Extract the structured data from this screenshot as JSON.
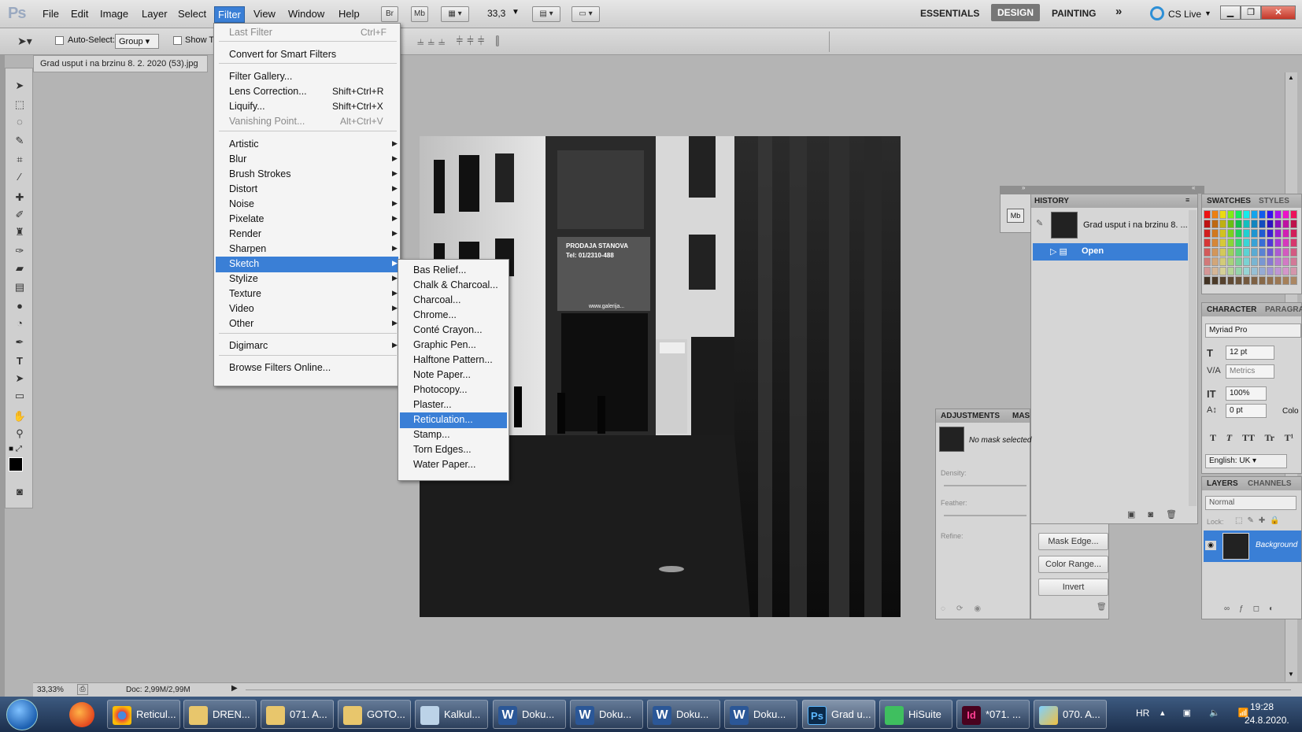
{
  "app": {
    "logo": "Ps"
  },
  "menubar": {
    "items": [
      "File",
      "Edit",
      "Image",
      "Layer",
      "Select",
      "Filter",
      "View",
      "Window",
      "Help"
    ],
    "bridge": "Br",
    "mini_bridge": "Mb",
    "zoom": "33,3",
    "workspaces": [
      "ESSENTIALS",
      "DESIGN",
      "PAINTING"
    ],
    "more": "»",
    "cslive": "CS Live"
  },
  "options": {
    "auto_select_label": "Auto-Select:",
    "auto_select_value": "Group",
    "show_transform": "Show T"
  },
  "document": {
    "tab_title": "Grad usput i na brzinu 8. 2. 2020 (53).jpg"
  },
  "filter_menu": {
    "last_filter": {
      "label": "Last Filter",
      "shortcut": "Ctrl+F"
    },
    "convert": "Convert for Smart Filters",
    "gallery": "Filter Gallery...",
    "lens": {
      "label": "Lens Correction...",
      "shortcut": "Shift+Ctrl+R"
    },
    "liquify": {
      "label": "Liquify...",
      "shortcut": "Shift+Ctrl+X"
    },
    "vanishing": {
      "label": "Vanishing Point...",
      "shortcut": "Alt+Ctrl+V"
    },
    "groups": [
      "Artistic",
      "Blur",
      "Brush Strokes",
      "Distort",
      "Noise",
      "Pixelate",
      "Render",
      "Sharpen",
      "Sketch",
      "Stylize",
      "Texture",
      "Video",
      "Other"
    ],
    "digimarc": "Digimarc",
    "browse": "Browse Filters Online..."
  },
  "sketch_submenu": {
    "items": [
      "Bas Relief...",
      "Chalk & Charcoal...",
      "Charcoal...",
      "Chrome...",
      "Conté Crayon...",
      "Graphic Pen...",
      "Halftone Pattern...",
      "Note Paper...",
      "Photocopy...",
      "Plaster...",
      "Reticulation...",
      "Stamp...",
      "Torn Edges...",
      "Water Paper..."
    ],
    "selected": "Reticulation..."
  },
  "photo_signs": {
    "sign1": "PRODAJA STANOVA",
    "sign2": "Tel: 01/2310-488",
    "sign3": "www.galerija..."
  },
  "history": {
    "tab": "HISTORY",
    "snapshot": "Grad usput i na brzinu 8. ...",
    "state": "Open"
  },
  "mini_bridge_label": "Mb",
  "adjustments": {
    "tabs": [
      "ADJUSTMENTS",
      "MAS"
    ],
    "no_mask": "No mask selected",
    "density": "Density:",
    "feather": "Feather:",
    "refine": "Refine:",
    "buttons": [
      "Mask Edge...",
      "Color Range...",
      "Invert"
    ]
  },
  "swatches": {
    "tabs": [
      "SWATCHES",
      "STYLES"
    ]
  },
  "character": {
    "tabs": [
      "CHARACTER",
      "PARAGRA"
    ],
    "font": "Myriad Pro",
    "size": "12 pt",
    "kerning": "Metrics",
    "scale": "100%",
    "baseline": "0 pt",
    "colo": "Colo",
    "language": "English: UK",
    "styles": [
      "T",
      "T",
      "TT",
      "Tr",
      "T¹"
    ]
  },
  "layers": {
    "tabs": [
      "LAYERS",
      "CHANNELS"
    ],
    "blend": "Normal",
    "lock": "Lock:",
    "layer_name": "Background"
  },
  "status": {
    "zoom": "33,33%",
    "doc": "Doc: 2,99M/2,99M"
  },
  "taskbar": {
    "tasks": [
      "Reticul...",
      "DREN...",
      "071. A...",
      "GOTO...",
      "Kalkul...",
      "Doku...",
      "Doku...",
      "Doku...",
      "Doku...",
      "Grad u...",
      "HiSuite",
      "*071. ...",
      "070. A..."
    ],
    "lang": "HR",
    "time": "19:28",
    "date": "24.8.2020."
  },
  "colors": {
    "highlight": "#3a7fd6",
    "taskbar": "#1c2f4c"
  }
}
